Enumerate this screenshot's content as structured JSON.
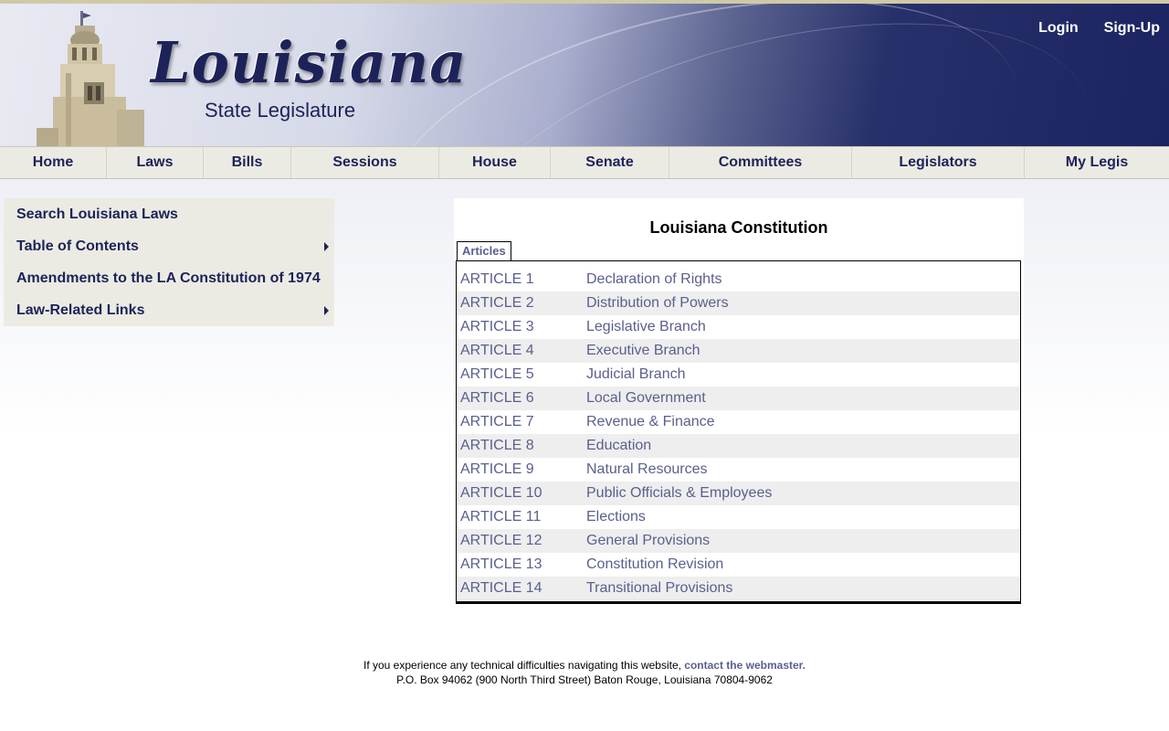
{
  "header": {
    "logo_title": "Louisiana",
    "logo_subtitle": "State Legislature",
    "login_label": "Login",
    "signup_label": "Sign-Up"
  },
  "nav": {
    "items": [
      {
        "label": "Home"
      },
      {
        "label": "Laws"
      },
      {
        "label": "Bills"
      },
      {
        "label": "Sessions"
      },
      {
        "label": "House"
      },
      {
        "label": "Senate"
      },
      {
        "label": "Committees"
      },
      {
        "label": "Legislators"
      },
      {
        "label": "My Legis"
      }
    ]
  },
  "sidebar": {
    "items": [
      {
        "label": "Search Louisiana Laws",
        "has_submenu": false
      },
      {
        "label": "Table of Contents",
        "has_submenu": true
      },
      {
        "label": "Amendments to the LA Constitution of 1974",
        "has_submenu": false
      },
      {
        "label": "Law-Related Links",
        "has_submenu": true
      }
    ]
  },
  "content": {
    "title": "Louisiana Constitution",
    "tab_label": "Articles",
    "articles": [
      {
        "number": "ARTICLE 1",
        "title": "Declaration of Rights"
      },
      {
        "number": "ARTICLE 2",
        "title": "Distribution of Powers"
      },
      {
        "number": "ARTICLE 3",
        "title": "Legislative Branch"
      },
      {
        "number": "ARTICLE 4",
        "title": "Executive Branch"
      },
      {
        "number": "ARTICLE 5",
        "title": "Judicial Branch"
      },
      {
        "number": "ARTICLE 6",
        "title": "Local Government"
      },
      {
        "number": "ARTICLE 7",
        "title": "Revenue & Finance"
      },
      {
        "number": "ARTICLE 8",
        "title": "Education"
      },
      {
        "number": "ARTICLE 9",
        "title": "Natural Resources"
      },
      {
        "number": "ARTICLE 10",
        "title": "Public Officials & Employees"
      },
      {
        "number": "ARTICLE 11",
        "title": "Elections"
      },
      {
        "number": "ARTICLE 12",
        "title": "General Provisions"
      },
      {
        "number": "ARTICLE 13",
        "title": "Constitution Revision"
      },
      {
        "number": "ARTICLE 14",
        "title": "Transitional Provisions"
      }
    ]
  },
  "footer": {
    "help_text": "If you experience any technical difficulties navigating this website, ",
    "webmaster_link": "contact the webmaster.",
    "address": "P.O. Box 94062 (900 North Third Street) Baton Rouge, Louisiana 70804-9062"
  },
  "colors": {
    "brand_navy": "#1d2359",
    "link_slate": "#5a5f8e",
    "nav_bg": "#ecebe3"
  }
}
